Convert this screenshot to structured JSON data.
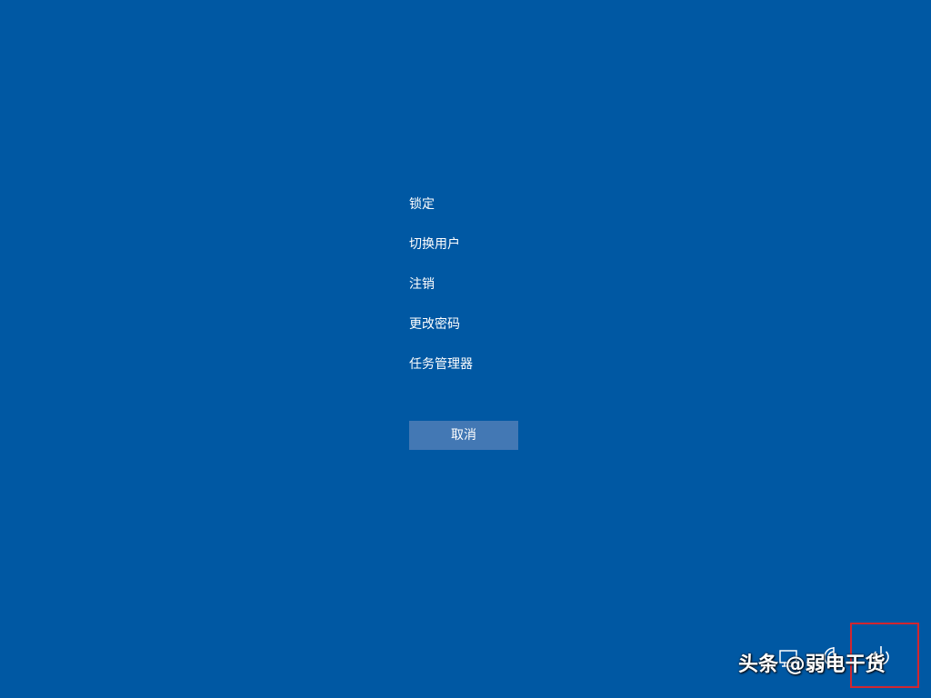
{
  "colors": {
    "background": "#0058a3",
    "button": "#4378b4",
    "text": "#ffffff",
    "highlight": "#d2262f"
  },
  "menu": {
    "items": [
      {
        "label": "锁定"
      },
      {
        "label": "切换用户"
      },
      {
        "label": "注销"
      },
      {
        "label": "更改密码"
      },
      {
        "label": "任务管理器"
      }
    ]
  },
  "cancel": {
    "label": "取消"
  },
  "tray": {
    "icons": [
      "network-icon",
      "accessibility-icon",
      "power-icon"
    ]
  },
  "watermark": {
    "text": "头条 @弱电干货"
  }
}
